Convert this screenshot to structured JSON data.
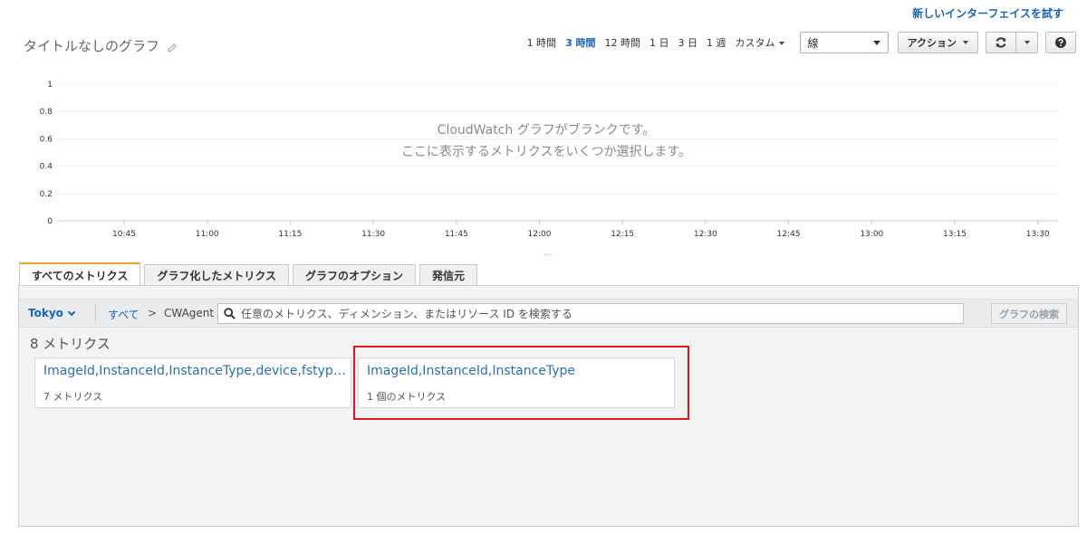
{
  "header": {
    "try_new_interface": "新しいインターフェイスを試す",
    "graph_title": "タイトルなしのグラフ"
  },
  "toolbar": {
    "time_ranges": [
      {
        "label": "1 時間",
        "active": false
      },
      {
        "label": "3 時間",
        "active": true
      },
      {
        "label": "12 時間",
        "active": false
      },
      {
        "label": "1 日",
        "active": false
      },
      {
        "label": "3 日",
        "active": false
      },
      {
        "label": "1 週",
        "active": false
      }
    ],
    "custom_label": "カスタム",
    "graph_type_selected": "線",
    "actions_label": "アクション"
  },
  "chart": {
    "blank_message_line1": "CloudWatch グラフがブランクです。",
    "blank_message_line2": "ここに表示するメトリクスをいくつか選択します。",
    "more_indicator": "..."
  },
  "chart_data": {
    "type": "line",
    "title": "",
    "xlabel": "",
    "ylabel": "",
    "x": [
      "10:45",
      "11:00",
      "11:15",
      "11:30",
      "11:45",
      "12:00",
      "12:15",
      "12:30",
      "12:45",
      "13:00",
      "13:15",
      "13:30"
    ],
    "y_ticks": [
      "0",
      "0.2",
      "0.4",
      "0.6",
      "0.8",
      "1"
    ],
    "ylim": [
      0,
      1
    ],
    "series": [],
    "grid": true,
    "legend": "none"
  },
  "tabs": [
    {
      "label": "すべてのメトリクス",
      "active": true
    },
    {
      "label": "グラフ化したメトリクス",
      "active": false
    },
    {
      "label": "グラフのオプション",
      "active": false
    },
    {
      "label": "発信元",
      "active": false
    }
  ],
  "browser": {
    "region": "Tokyo",
    "breadcrumb_all": "すべて",
    "breadcrumb_sep": ">",
    "breadcrumb_current": "CWAgent",
    "search_placeholder": "任意のメトリクス、ディメンション、またはリソース ID を検索する",
    "graph_search_label": "グラフの検索",
    "metric_count": "8 メトリクス",
    "cards": [
      {
        "title": "ImageId,InstanceId,InstanceType,device,fstype,path",
        "subtitle": "7 メトリクス"
      },
      {
        "title": "ImageId,InstanceId,InstanceType",
        "subtitle": "1 個のメトリクス"
      }
    ]
  },
  "colors": {
    "link": "#1a64b4",
    "tab_accent": "#e4a42d",
    "highlight": "#e0161b"
  }
}
